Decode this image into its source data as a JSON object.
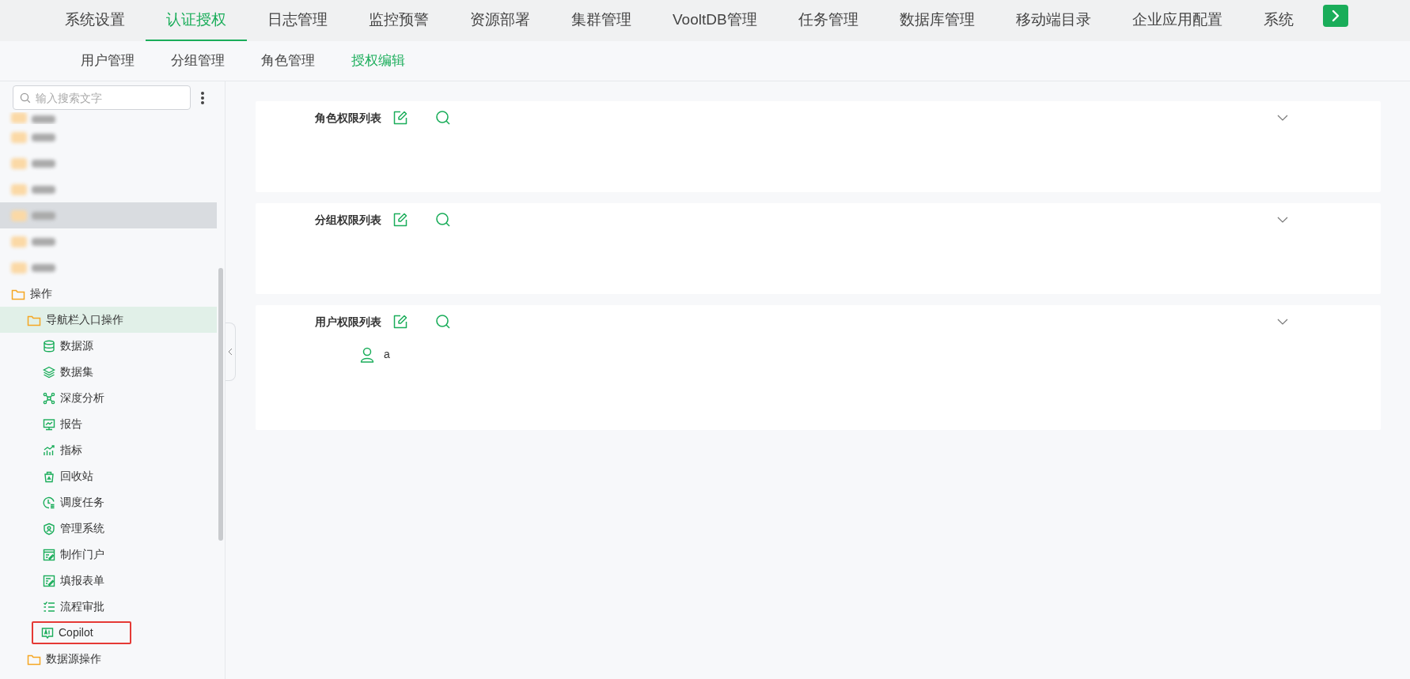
{
  "top_nav": {
    "items": [
      {
        "label": "系统设置",
        "selected": false
      },
      {
        "label": "认证授权",
        "selected": true
      },
      {
        "label": "日志管理",
        "selected": false
      },
      {
        "label": "监控预警",
        "selected": false
      },
      {
        "label": "资源部署",
        "selected": false
      },
      {
        "label": "集群管理",
        "selected": false
      },
      {
        "label": "VooltDB管理",
        "selected": false
      },
      {
        "label": "任务管理",
        "selected": false
      },
      {
        "label": "数据库管理",
        "selected": false
      },
      {
        "label": "移动端目录",
        "selected": false
      },
      {
        "label": "企业应用配置",
        "selected": false
      },
      {
        "label": "系统",
        "selected": false
      }
    ]
  },
  "sub_nav": {
    "items": [
      {
        "label": "用户管理",
        "selected": false
      },
      {
        "label": "分组管理",
        "selected": false
      },
      {
        "label": "角色管理",
        "selected": false
      },
      {
        "label": "授权编辑",
        "selected": true
      }
    ]
  },
  "sidebar": {
    "search": {
      "placeholder": "输入搜索文字"
    },
    "tree": [
      {
        "kind": "blurred",
        "hovered": false
      },
      {
        "kind": "blurred",
        "hovered": false
      },
      {
        "kind": "blurred",
        "hovered": false
      },
      {
        "kind": "blurred",
        "hovered": false
      },
      {
        "kind": "blurred",
        "hovered": true
      },
      {
        "kind": "blurred",
        "hovered": false
      },
      {
        "kind": "blurred",
        "hovered": false
      },
      {
        "kind": "folder",
        "label": "操作",
        "selected": false,
        "children": [
          {
            "kind": "folder",
            "label": "导航栏入口操作",
            "selected": true,
            "children": [
              {
                "kind": "database",
                "label": "数据源",
                "selected": false
              },
              {
                "kind": "layers",
                "label": "数据集",
                "selected": false
              },
              {
                "kind": "network",
                "label": "深度分析",
                "selected": false
              },
              {
                "kind": "monitor",
                "label": "报告",
                "selected": false
              },
              {
                "kind": "chart",
                "label": "指标",
                "selected": false
              },
              {
                "kind": "bin",
                "label": "回收站",
                "selected": false
              },
              {
                "kind": "clock",
                "label": "调度任务",
                "selected": false
              },
              {
                "kind": "shield",
                "label": "管理系统",
                "selected": false
              },
              {
                "kind": "portal",
                "label": "制作门户",
                "selected": false
              },
              {
                "kind": "form",
                "label": "填报表单",
                "selected": false
              },
              {
                "kind": "list",
                "label": "流程审批",
                "selected": false
              },
              {
                "kind": "ai",
                "label": "Copilot",
                "selected": false,
                "marked": true
              }
            ]
          },
          {
            "kind": "folder",
            "label": "数据源操作",
            "selected": false
          }
        ]
      }
    ]
  },
  "panels": [
    {
      "title": "角色权限列表"
    },
    {
      "title": "分组权限列表"
    },
    {
      "title": "用户权限列表",
      "users": [
        "a"
      ]
    }
  ]
}
